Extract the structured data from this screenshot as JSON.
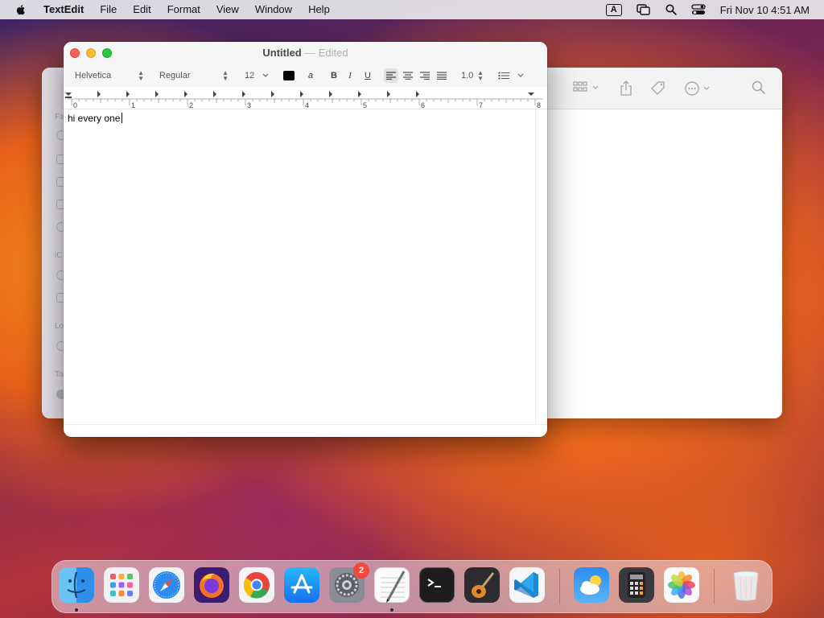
{
  "menubar": {
    "app_name": "TextEdit",
    "items": [
      "File",
      "Edit",
      "Format",
      "View",
      "Window",
      "Help"
    ],
    "input_source": "A",
    "clock": "Fri Nov 10  4:51 AM",
    "icons": [
      "apple-icon",
      "input-source-icon",
      "screen-mirroring-icon",
      "spotlight-search-icon",
      "control-center-icon"
    ]
  },
  "textedit": {
    "title": "Untitled",
    "separator": "—",
    "status": "Edited",
    "format": {
      "font_family": "Helvetica",
      "font_style": "Regular",
      "font_size": "12",
      "bold_label": "B",
      "italic_label": "I",
      "underline_label": "U",
      "line_spacing": "1.0",
      "highlight_label": "a",
      "text_color": "#000000",
      "active_alignment": "left"
    },
    "ruler": {
      "labels": [
        "0",
        "1",
        "2",
        "3",
        "4",
        "5",
        "6",
        "7",
        "8"
      ]
    },
    "content": "hi every one"
  },
  "finder": {
    "sidebar_labels": [
      "Fa",
      "iC",
      "Lo",
      "Ta"
    ],
    "toolbar_icons": [
      "view-grid-icon",
      "share-icon",
      "tag-icon",
      "more-actions-icon",
      "search-icon"
    ]
  },
  "dock": {
    "apps": [
      {
        "name": "Finder",
        "icon": "finder-icon",
        "running": true
      },
      {
        "name": "Launchpad",
        "icon": "launchpad-icon",
        "running": false
      },
      {
        "name": "Safari",
        "icon": "safari-icon",
        "running": false
      },
      {
        "name": "Firefox",
        "icon": "firefox-icon",
        "running": false
      },
      {
        "name": "Chrome",
        "icon": "chrome-icon",
        "running": false
      },
      {
        "name": "App Store",
        "icon": "app-store-icon",
        "running": false
      },
      {
        "name": "System Preferences",
        "icon": "system-preferences-icon",
        "running": false,
        "badge": "2"
      },
      {
        "name": "TextEdit",
        "icon": "textedit-icon",
        "running": true
      },
      {
        "name": "Terminal",
        "icon": "terminal-icon",
        "running": false
      },
      {
        "name": "GarageBand",
        "icon": "garageband-icon",
        "running": false
      },
      {
        "name": "Visual Studio Code",
        "icon": "vscode-icon",
        "running": false
      },
      {
        "name": "Weather",
        "icon": "weather-icon",
        "running": false
      },
      {
        "name": "Calculator",
        "icon": "calculator-icon",
        "running": false
      },
      {
        "name": "Photos",
        "icon": "photos-icon",
        "running": false
      },
      {
        "name": "Trash",
        "icon": "trash-icon",
        "running": false
      }
    ],
    "colors": {
      "badge": "#f5483d",
      "traffic_close": "#fe5f57",
      "traffic_minimize": "#febc2e",
      "traffic_zoom": "#28c840"
    }
  }
}
